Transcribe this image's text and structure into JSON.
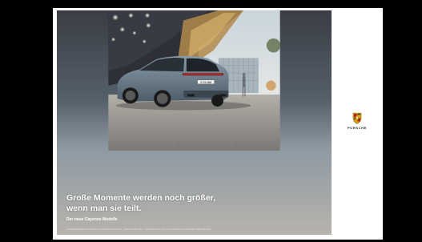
{
  "ad": {
    "headline_line1": "Große Momente werden noch größer,",
    "headline_line2": "wenn man sie teilt.",
    "subheadline": "Der neue Cayenne Modelle",
    "fine_print": "Kraftstoffverbrauch (in l/100 km) innerorts 11,9–11,5 · außerorts 8,4–8,1 · kombiniert 9,2–9,0; CO₂-Emissionen kombiniert 209–205 g/km",
    "license_plate": "S·PA 666",
    "brand_wordmark": "PORSCHE"
  },
  "colors": {
    "frame_bg": "#000000",
    "page_bg": "#ffffff",
    "car_body": "#6f8393",
    "crest_gold": "#d4a017",
    "crest_red": "#b22222"
  },
  "icons": {
    "logo": "porsche-crest-icon"
  }
}
